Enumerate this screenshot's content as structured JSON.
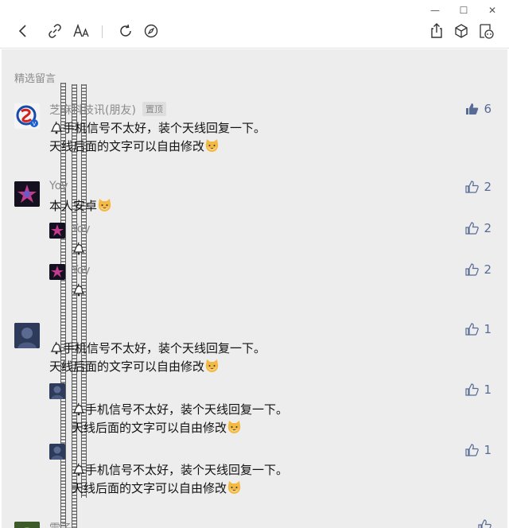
{
  "window_controls": {
    "minimize": "—",
    "maximize": "☐",
    "close": "✕"
  },
  "section_title": "精选留言",
  "comments": [
    {
      "nick": "芝麻科技讯(朋友)",
      "badge": "置顶",
      "line1": "手机信号不太好，装个天线回复一下。",
      "line2": "天线后面的文字可以自由修改",
      "likes": "6",
      "liked": true
    },
    {
      "nick": "Yoy",
      "line1": "本人安卓",
      "likes": "2",
      "replies": [
        {
          "nick": "Yoy",
          "likes": "2"
        },
        {
          "nick": "Yoy",
          "likes": "2"
        }
      ]
    },
    {
      "nick": "",
      "line1": "手机信号不太好，装个天线回复一下。",
      "line2": "天线后面的文字可以自由修改",
      "likes": "1",
      "replies": [
        {
          "line1": "手机信号不太好，装个天线回复一下。",
          "line2": "天线后面的文字可以自由修改",
          "likes": "1"
        },
        {
          "line1": "手机信号不太好，装个天线回复一下。",
          "line2": "天线后面的文字可以自由修改",
          "likes": "1"
        }
      ]
    },
    {
      "nick": "雷子"
    }
  ],
  "colors": {
    "link_blue": "#576b95",
    "bg_gray": "#ededed",
    "meta_gray": "#8a8a8a"
  },
  "icons": [
    "back-icon",
    "link-icon",
    "font-size-icon",
    "refresh-icon",
    "compass-icon",
    "share-icon",
    "cube-icon",
    "mini-program-icon",
    "thumb-up-icon",
    "bell-icon",
    "cat-emoji-icon"
  ]
}
